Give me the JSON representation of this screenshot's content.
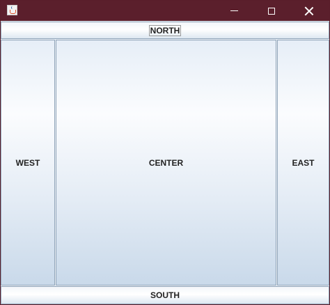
{
  "window": {
    "icon": "java-icon",
    "controls": {
      "minimize": "minimize-icon",
      "maximize": "maximize-icon",
      "close": "close-icon"
    }
  },
  "buttons": {
    "north": "NORTH",
    "west": "WEST",
    "center": "CENTER",
    "east": "EAST",
    "south": "SOUTH"
  },
  "colors": {
    "titlebar": "#5b1f2c",
    "button_border": "#8fa3b8"
  }
}
